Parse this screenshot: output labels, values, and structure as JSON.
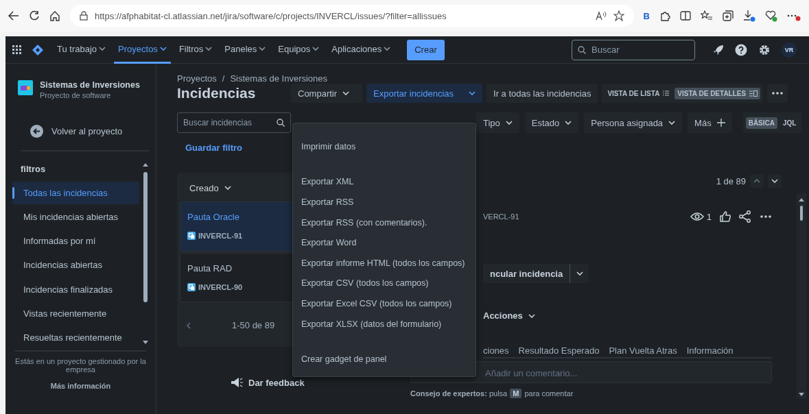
{
  "browser": {
    "url": "https://afphabitat-cl.atlassian.net/jira/software/c/projects/INVERCL/issues/?filter=allissues",
    "profile_badge": "B"
  },
  "nav": {
    "items": [
      {
        "label": "Tu trabajo",
        "selected": false
      },
      {
        "label": "Proyectos",
        "selected": true
      },
      {
        "label": "Filtros",
        "selected": false
      },
      {
        "label": "Paneles",
        "selected": false
      },
      {
        "label": "Equipos",
        "selected": false
      },
      {
        "label": "Aplicaciones",
        "selected": false
      }
    ],
    "create_button": "Crear",
    "search_placeholder": "Buscar",
    "avatar": "VR"
  },
  "sidebar": {
    "project": {
      "name": "Sistemas de Inversiones",
      "type": "Proyecto de software"
    },
    "back_link": "Volver al proyecto",
    "section_title": "filtros",
    "items": [
      {
        "label": "Todas las incidencias",
        "selected": true
      },
      {
        "label": "Mis incidencias abiertas",
        "selected": false
      },
      {
        "label": "Informadas por mí",
        "selected": false
      },
      {
        "label": "Incidencias abiertas",
        "selected": false
      },
      {
        "label": "Incidencias finalizadas",
        "selected": false
      },
      {
        "label": "Vistas recientemente",
        "selected": false
      },
      {
        "label": "Resueltas recientemente",
        "selected": false
      }
    ],
    "footer_text": "Estás en un proyecto gestionado por la empresa",
    "footer_link": "Más información"
  },
  "main": {
    "breadcrumb": [
      "Proyectos",
      "Sistemas de Inversiones"
    ],
    "breadcrumb_separator": "/",
    "title": "Incidencias",
    "toolbar": {
      "share": "Compartir",
      "export": {
        "label": "Exportar incidencias",
        "expanded": true
      },
      "go_all": "Ir a todas las incidencias",
      "views": [
        {
          "label": "VISTA DE LISTA",
          "selected": false
        },
        {
          "label": "VISTA DE DETALLES",
          "selected": true
        }
      ]
    },
    "filters": {
      "search_placeholder": "Buscar incidencias",
      "dropdowns": [
        "Tipo",
        "Estado",
        "Persona asignada"
      ],
      "more": "Más",
      "modes": [
        {
          "label": "BÁSICA",
          "selected": true
        },
        {
          "label": "JQL",
          "selected": false
        }
      ]
    },
    "save_filter": "Guardar filtro",
    "list": {
      "sort": "Creado",
      "items": [
        {
          "title": "Pauta Oracle",
          "key": "INVERCL-91",
          "selected": true
        },
        {
          "title": "Pauta RAD",
          "key": "INVERCL-90",
          "selected": false
        }
      ],
      "pager": "1-50 de 89"
    },
    "feedback": "Dar feedback"
  },
  "detail": {
    "counter": "1 de 89",
    "key": "VERCL-91",
    "watchers": "1",
    "link_button": "ncular incidencia",
    "actions": "Acciones",
    "tabs": [
      "ciones",
      "Resultado Esperado",
      "Plan Vuelta Atras",
      "Información"
    ],
    "comment_placeholder": "Añadir un comentario...",
    "tip": "**Consejo de expertos:** pulsa",
    "tip_key": "M",
    "tip_after": "para comentar"
  },
  "export_menu": [
    [
      "Imprimir datos"
    ],
    [
      "Exportar XML",
      "Exportar RSS",
      "Exportar RSS (con comentarios).",
      "Exportar Word",
      "Exportar informe HTML (todos los campos)",
      "Exportar CSV (todos los campos)",
      "Exportar Excel CSV (todos los campos)",
      "Exportar XLSX (datos del formulario)"
    ],
    [
      "Crear gadget de panel"
    ]
  ]
}
